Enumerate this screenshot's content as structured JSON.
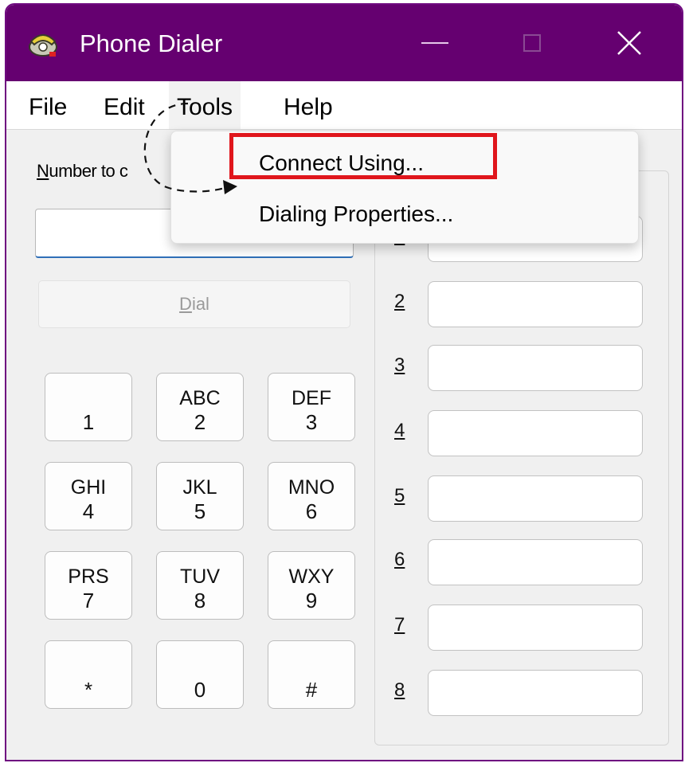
{
  "window": {
    "title": "Phone Dialer",
    "accent_color": "#650070",
    "controls": [
      "minimize-icon",
      "maximize-icon",
      "close-icon"
    ],
    "close_glyph": "✕"
  },
  "menubar": {
    "items": [
      {
        "label": "File"
      },
      {
        "label": "Edit"
      },
      {
        "label": "Tools"
      },
      {
        "label": "Help"
      }
    ]
  },
  "tools_menu": {
    "items": [
      {
        "label": "Connect Using..."
      },
      {
        "label": "Dialing Properties..."
      }
    ],
    "highlight_color": "#e0161c"
  },
  "main": {
    "number_label_first": "N",
    "number_label_rest": "umber to c",
    "number_value": "",
    "dial_first": "D",
    "dial_rest": "ial"
  },
  "keypad": [
    {
      "letters": "",
      "digit": "1"
    },
    {
      "letters": "ABC",
      "digit": "2"
    },
    {
      "letters": "DEF",
      "digit": "3"
    },
    {
      "letters": "GHI",
      "digit": "4"
    },
    {
      "letters": "JKL",
      "digit": "5"
    },
    {
      "letters": "MNO",
      "digit": "6"
    },
    {
      "letters": "PRS",
      "digit": "7"
    },
    {
      "letters": "TUV",
      "digit": "8"
    },
    {
      "letters": "WXY",
      "digit": "9"
    },
    {
      "letters": "",
      "digit": "*"
    },
    {
      "letters": "",
      "digit": "0"
    },
    {
      "letters": "",
      "digit": "#"
    }
  ],
  "speed_dial": {
    "numbers": [
      "1",
      "2",
      "3",
      "4",
      "5",
      "6",
      "7",
      "8"
    ]
  }
}
